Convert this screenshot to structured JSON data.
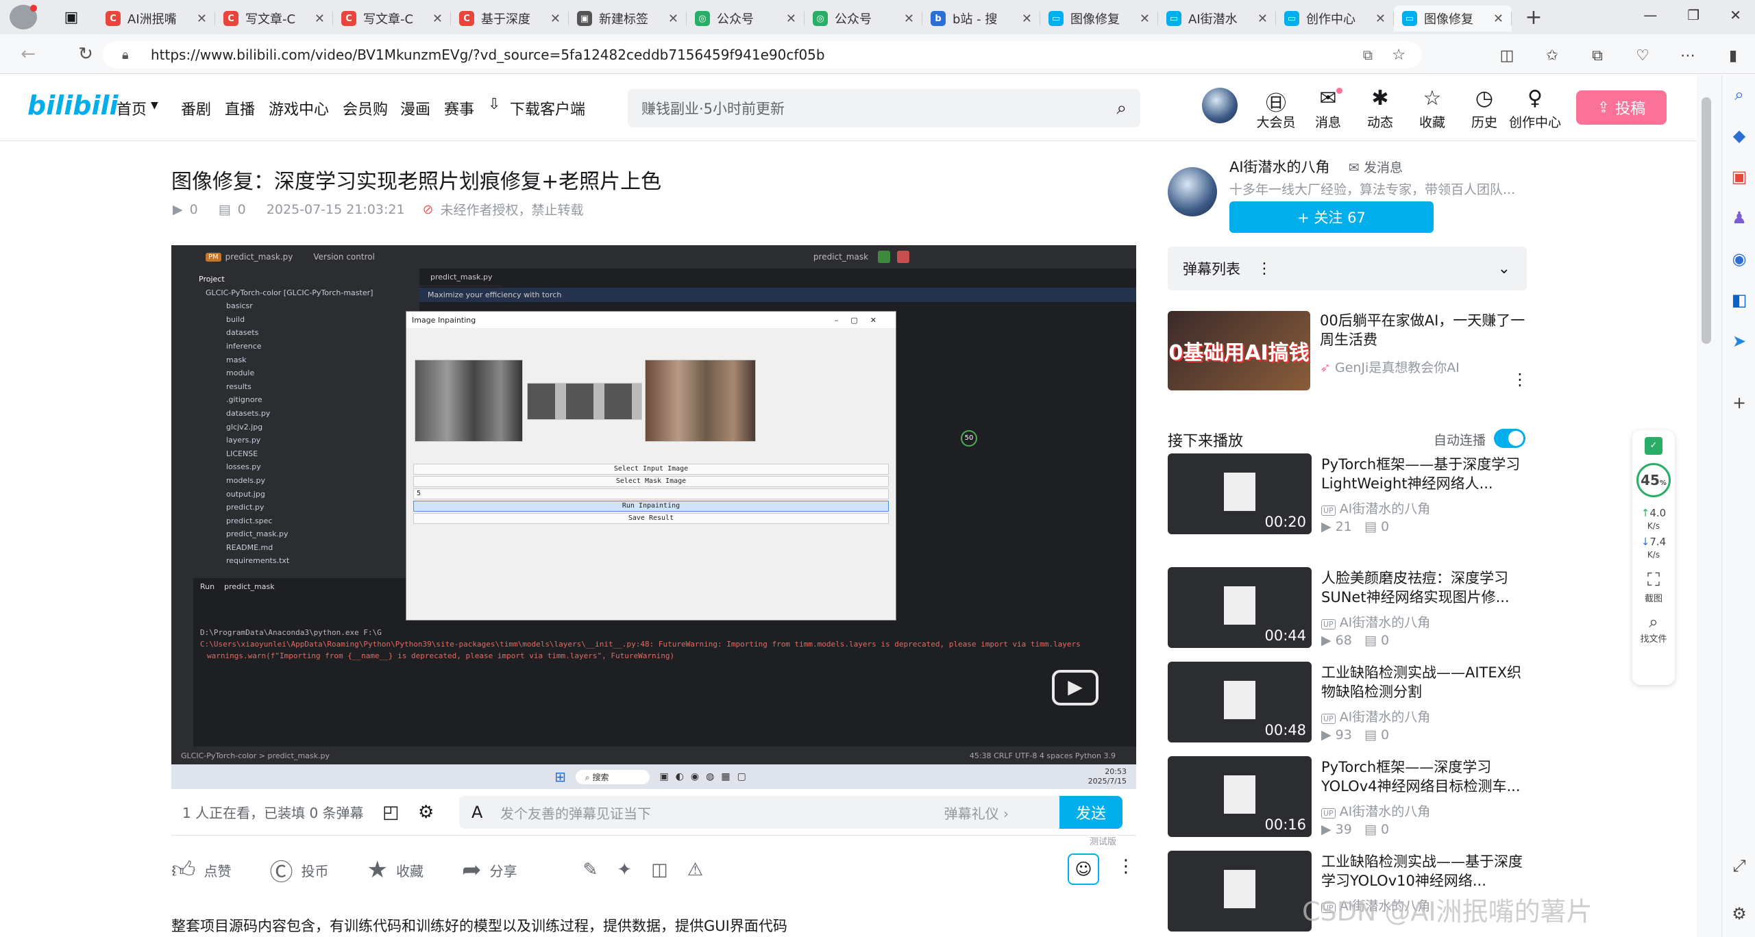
{
  "browser": {
    "tabs": [
      {
        "label": "AI洲抿嘴",
        "icon_color": "#e8453c",
        "icon": "C"
      },
      {
        "label": "写文章-C",
        "icon_color": "#e8453c",
        "icon": "C"
      },
      {
        "label": "写文章-C",
        "icon_color": "#e8453c",
        "icon": "C"
      },
      {
        "label": "基于深度",
        "icon_color": "#e8453c",
        "icon": "C"
      },
      {
        "label": "新建标签",
        "icon_color": "#555555",
        "icon": "▣"
      },
      {
        "label": "公众号",
        "icon_color": "#2aae67",
        "icon": "◎"
      },
      {
        "label": "公众号",
        "icon_color": "#2aae67",
        "icon": "◎"
      },
      {
        "label": "b站 - 搜",
        "icon_color": "#2b6fd6",
        "icon": "b"
      },
      {
        "label": "图像修复",
        "icon_color": "#00aeec",
        "icon": "▭"
      },
      {
        "label": "AI街潜水",
        "icon_color": "#00aeec",
        "icon": "▭"
      },
      {
        "label": "创作中心",
        "icon_color": "#00aeec",
        "icon": "▭"
      },
      {
        "label": "图像修复",
        "icon_color": "#00aeec",
        "icon": "▭"
      }
    ],
    "url": "https://www.bilibili.com/video/BV1MkunzmEVg/?vd_source=5fa12482ceddb7156459f941e90cf05b"
  },
  "header": {
    "logo": "bilibili",
    "nav": [
      "首页",
      "番剧",
      "直播",
      "游戏中心",
      "会员购",
      "漫画",
      "赛事",
      "下载客户端"
    ],
    "search_placeholder": "赚钱副业·5小时前更新",
    "icons": [
      {
        "label": "大会员",
        "icon": "vip-icon",
        "glyph": "㊐"
      },
      {
        "label": "消息",
        "icon": "message-icon",
        "glyph": "✉"
      },
      {
        "label": "动态",
        "icon": "dynamic-icon",
        "glyph": "✱"
      },
      {
        "label": "收藏",
        "icon": "star-icon",
        "glyph": "☆"
      },
      {
        "label": "历史",
        "icon": "clock-icon",
        "glyph": "◷"
      },
      {
        "label": "创作中心",
        "icon": "bulb-icon",
        "glyph": "♀"
      }
    ],
    "upload_label": "投稿"
  },
  "video": {
    "title": "图像修复：深度学习实现老照片划痕修复+老照片上色",
    "views": "0",
    "danmaku_count": "0",
    "datetime": "2025-07-15 21:03:21",
    "copyright": "未经作者授权，禁止转载"
  },
  "player_content": {
    "ide_file": "predict_mask.py",
    "version_control": "Version control",
    "project_label": "Project",
    "project_root": "GLCIC-PyTorch-color [GLCIC-PyTorch-master]",
    "tree_items": [
      "basicsr",
      "build",
      "datasets",
      "inference",
      "mask",
      "module",
      "results",
      ".gitignore",
      "datasets.py",
      "glcjv2.jpg",
      "layers.py",
      "LICENSE",
      "losses.py",
      "models.py",
      "output.jpg",
      "predict.py",
      "predict.spec",
      "predict_mask.py",
      "README.md",
      "requirements.txt"
    ],
    "banner": "Maximize your efficiency with torch",
    "dialog_title": "Image Inpainting",
    "dialog_buttons": [
      "Select Input Image",
      "Select Mask Image",
      "Run Inpainting",
      "Save Result"
    ],
    "spin_value": "5",
    "run_tab": "Run",
    "run_config": "predict_mask",
    "console": [
      "D:\\ProgramData\\Anaconda3\\python.exe F:\\G",
      "C:\\Users\\xiaoyunlei\\AppData\\Roaming\\Python\\Python39\\site-packages\\timm\\models\\layers\\__init__.py:48: FutureWarning: Importing from timm.models.layers is deprecated, please import via timm.layers",
      "warnings.warn(f\"Importing from {__name__} is deprecated, please import via timm.layers\", FutureWarning)"
    ],
    "status_left": "GLCIC-PyTorch-color  >  predict_mask.py",
    "status_right": "45:38   CRLF   UTF-8   4 spaces   Python 3.9",
    "taskbar_search": "搜索",
    "taskbar_time": "20:53",
    "taskbar_date": "2025/7/15",
    "gauge": "50"
  },
  "danmaku_bar": {
    "watching": "1 人正在看，已装填 0 条弹幕",
    "placeholder": "发个友善的弹幕见证当下",
    "etiquette": "弹幕礼仪",
    "send": "发送"
  },
  "actions": {
    "like": "点赞",
    "coin": "投币",
    "favorite": "收藏",
    "share": "分享",
    "beta_tag": "测试版"
  },
  "description": "整套项目源码内容包含，有训练代码和训练好的模型以及训练过程，提供数据，提供GUI界面代码",
  "uploader": {
    "name": "AI街潜水的八角",
    "message": "发消息",
    "signature": "十多年一线大厂经验，算法专家，带领百人团队...",
    "follow": "+ 关注 67"
  },
  "danmaku_list_label": "弹幕列表",
  "ad": {
    "title": "00后躺平在家做AI，一天赚了一周生活费",
    "author": "GenJi是真想教会你AI",
    "thumb_text": "0基础用AI搞钱"
  },
  "next_play": {
    "label": "接下来播放",
    "autoplay": "自动连播"
  },
  "recommendations": [
    {
      "title": "PyTorch框架——基于深度学习LightWeight神经网络人...",
      "author": "AI街潜水的八角",
      "plays": "21",
      "danmaku": "0",
      "duration": "00:20"
    },
    {
      "title": "人脸美颜磨皮祛痘：深度学习SUNet神经网络实现图片修...",
      "author": "AI街潜水的八角",
      "plays": "68",
      "danmaku": "0",
      "duration": "00:44"
    },
    {
      "title": "工业缺陷检测实战——AITEX织物缺陷检测分割",
      "author": "AI街潜水的八角",
      "plays": "93",
      "danmaku": "0",
      "duration": "00:48"
    },
    {
      "title": "PyTorch框架——深度学习YOLOv4神经网络目标检测车...",
      "author": "AI街潜水的八角",
      "plays": "39",
      "danmaku": "0",
      "duration": "00:16"
    },
    {
      "title": "工业缺陷检测实战——基于深度学习YOLOv10神经网络...",
      "author": "AI街潜水的八角",
      "plays": "",
      "danmaku": "",
      "duration": ""
    }
  ],
  "widget": {
    "percent": "45",
    "up": "4.0",
    "up_unit": "K/s",
    "down": "7.4",
    "down_unit": "K/s",
    "screenshot": "截图",
    "find_file": "找文件"
  },
  "watermark": "CSDN @AI洲抿嘴的薯片",
  "colors": {
    "brand": "#00aeec",
    "pink": "#fb7299"
  }
}
